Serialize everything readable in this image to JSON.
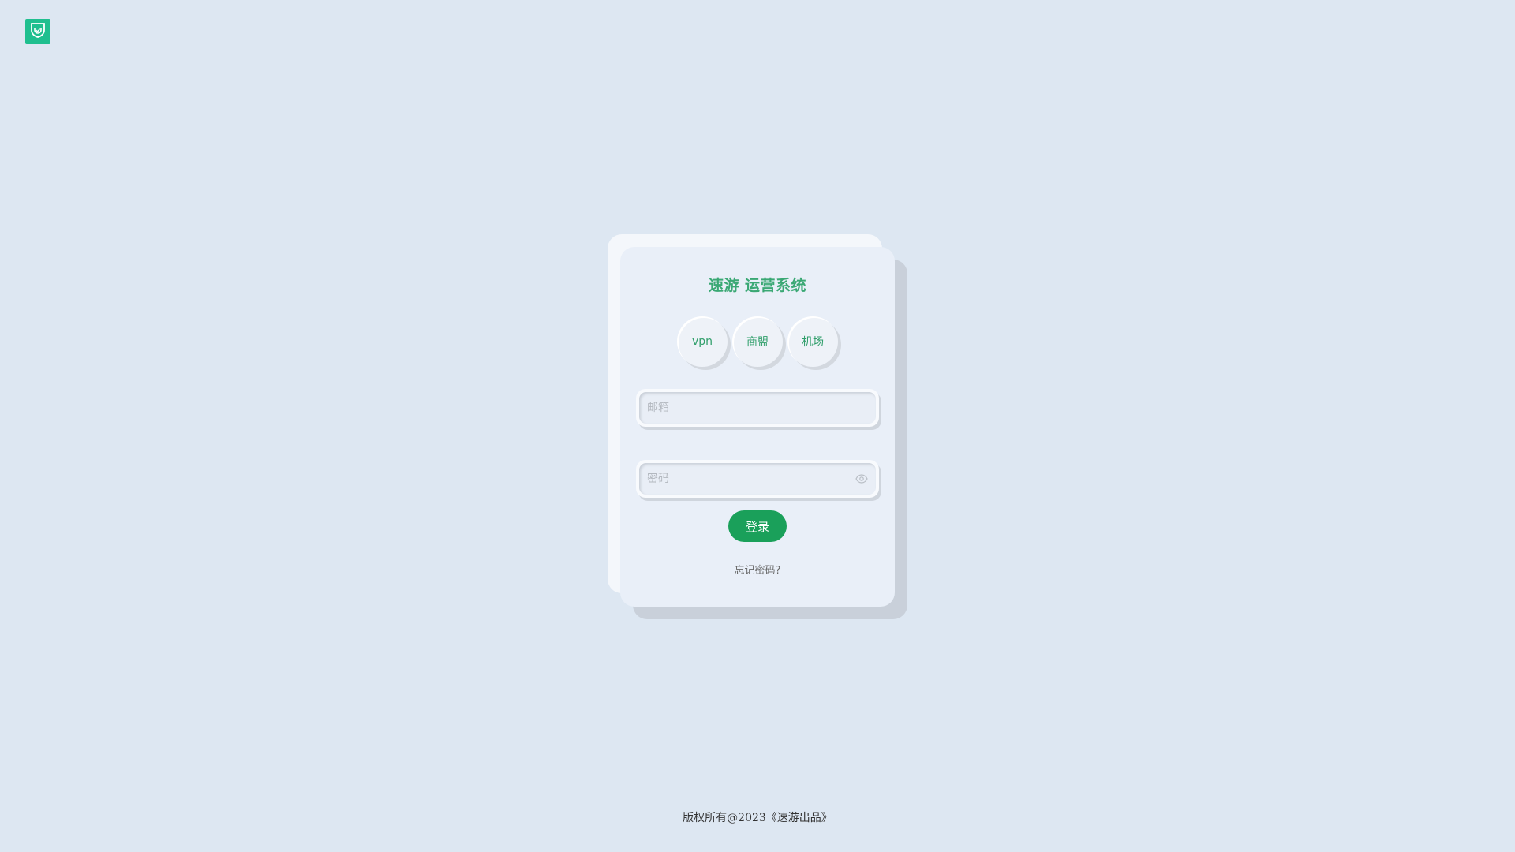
{
  "logo": {
    "icon": "shield-check-icon",
    "color": "#1fbf8f"
  },
  "login": {
    "title": "速游 运营系统",
    "tabs": [
      {
        "label": "vpn"
      },
      {
        "label": "商盟"
      },
      {
        "label": "机场"
      }
    ],
    "email_placeholder": "邮箱",
    "password_placeholder": "密码",
    "password_toggle_icon": "eye-icon",
    "submit_label": "登录",
    "forgot_label": "忘记密码?"
  },
  "footer": {
    "copyright": "版权所有@2023《速游出品》"
  },
  "colors": {
    "background": "#dde7f2",
    "accent": "#3aa874",
    "button": "#1aa05a"
  }
}
